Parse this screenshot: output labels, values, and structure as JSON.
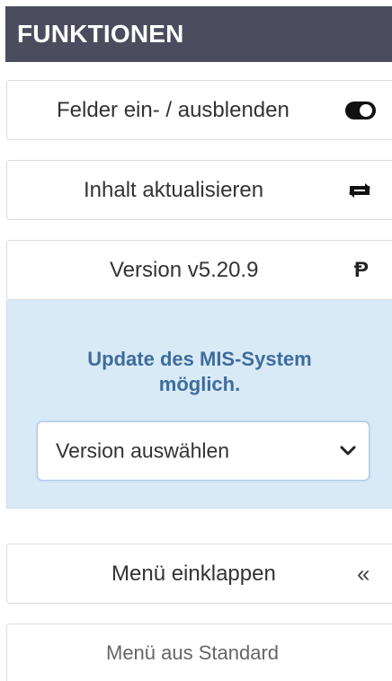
{
  "header": {
    "title": "FUNKTIONEN"
  },
  "buttons": {
    "toggle_fields": {
      "label": "Felder ein- / ausblenden",
      "icon": "toggle-icon"
    },
    "refresh_content": {
      "label": "Inhalt aktualisieren",
      "icon": "retweet-icon"
    },
    "version": {
      "label": "Version v5.20.9",
      "icon": "p-glyph",
      "glyph": "Ᵽ"
    },
    "collapse_menu": {
      "label": "Menü einklappen",
      "icon": "double-chevron-left-icon",
      "glyph": "«"
    },
    "menu_standard": {
      "label": "Menü aus Standard"
    }
  },
  "update_notice": {
    "line1": "Update des MIS-System",
    "line2": "möglich.",
    "select": {
      "selected": "Version auswählen"
    }
  },
  "colors": {
    "header_bg": "#4b4d5e",
    "notice_bg": "#d9eaf7",
    "notice_text": "#3e6d9c"
  }
}
